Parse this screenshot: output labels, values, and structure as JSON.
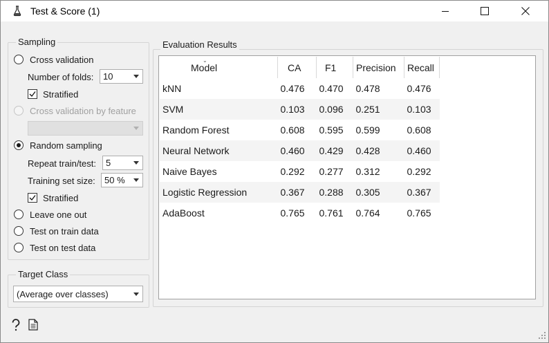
{
  "window": {
    "title": "Test & Score (1)",
    "minimize_icon": "minimize-icon",
    "maximize_icon": "maximize-icon",
    "close_icon": "close-icon"
  },
  "sampling": {
    "title": "Sampling",
    "cross_validation": {
      "label": "Cross validation",
      "checked": false
    },
    "folds": {
      "label": "Number of folds:",
      "value": "10"
    },
    "stratified_cv": {
      "label": "Stratified",
      "checked": true
    },
    "cv_by_feature": {
      "label": "Cross validation by feature",
      "disabled": true,
      "value": ""
    },
    "random_sampling": {
      "label": "Random sampling",
      "checked": true
    },
    "repeat": {
      "label": "Repeat train/test:",
      "value": "5"
    },
    "train_size": {
      "label": "Training set size:",
      "value": "50 %"
    },
    "stratified_rs": {
      "label": "Stratified",
      "checked": true
    },
    "leave_one_out": {
      "label": "Leave one out",
      "checked": false
    },
    "test_on_train": {
      "label": "Test on train data",
      "checked": false
    },
    "test_on_test": {
      "label": "Test on test data",
      "checked": false
    }
  },
  "target_class": {
    "title": "Target Class",
    "value": "(Average over classes)"
  },
  "results": {
    "title": "Evaluation Results",
    "columns": [
      "Model",
      "CA",
      "F1",
      "Precision",
      "Recall"
    ],
    "rows": [
      [
        "kNN",
        "0.476",
        "0.470",
        "0.478",
        "0.476"
      ],
      [
        "SVM",
        "0.103",
        "0.096",
        "0.251",
        "0.103"
      ],
      [
        "Random Forest",
        "0.608",
        "0.595",
        "0.599",
        "0.608"
      ],
      [
        "Neural Network",
        "0.460",
        "0.429",
        "0.428",
        "0.460"
      ],
      [
        "Naive Bayes",
        "0.292",
        "0.277",
        "0.312",
        "0.292"
      ],
      [
        "Logistic Regression",
        "0.367",
        "0.288",
        "0.305",
        "0.367"
      ],
      [
        "AdaBoost",
        "0.765",
        "0.761",
        "0.764",
        "0.765"
      ]
    ]
  },
  "status_bar": {
    "help_icon": "help-icon",
    "report_icon": "report-icon"
  }
}
